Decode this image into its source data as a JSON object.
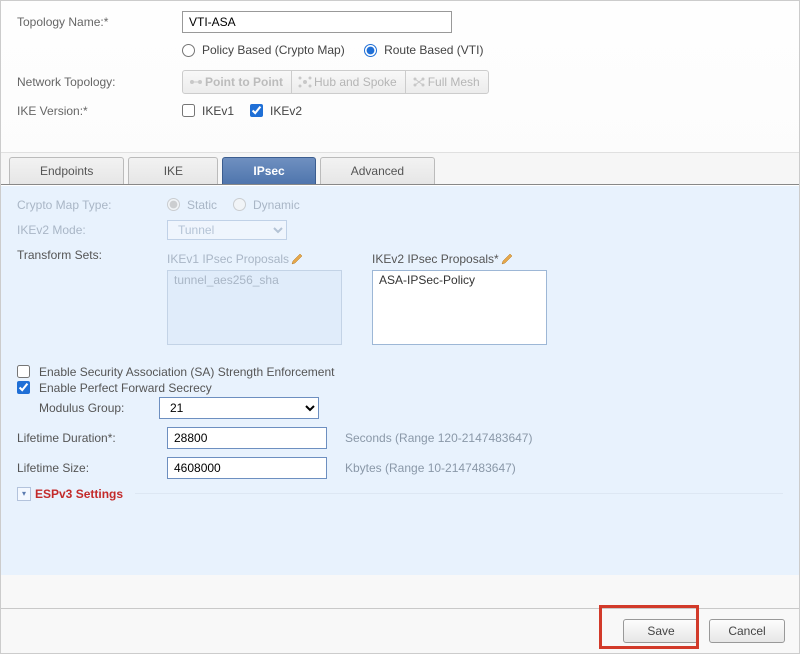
{
  "top": {
    "topology_name_label": "Topology Name:*",
    "topology_name_value": "VTI-ASA",
    "radio_policy": "Policy Based (Crypto Map)",
    "radio_route": "Route Based (VTI)",
    "network_topology_label": "Network Topology:",
    "seg_point": "Point to Point",
    "seg_hub": "Hub and Spoke",
    "seg_full": "Full Mesh",
    "ike_version_label": "IKE Version:*",
    "ikev1_label": "IKEv1",
    "ikev2_label": "IKEv2"
  },
  "tabs": {
    "endpoints": "Endpoints",
    "ike": "IKE",
    "ipsec": "IPsec",
    "advanced": "Advanced"
  },
  "ipsec": {
    "crypto_map_type_label": "Crypto Map Type:",
    "crypto_static": "Static",
    "crypto_dynamic": "Dynamic",
    "ikev2_mode_label": "IKEv2 Mode:",
    "ikev2_mode_value": "Tunnel",
    "transform_sets_label": "Transform Sets:",
    "ikev1_prop_label": "IKEv1 IPsec Proposals",
    "ikev1_prop_item": "tunnel_aes256_sha",
    "ikev2_prop_label": "IKEv2 IPsec Proposals*",
    "ikev2_prop_item": "ASA-IPSec-Policy",
    "sa_enforce_label": "Enable Security Association (SA) Strength Enforcement",
    "pfs_label": "Enable Perfect Forward Secrecy",
    "modulus_label": "Modulus Group:",
    "modulus_value": "21",
    "lifetime_dur_label": "Lifetime Duration*:",
    "lifetime_dur_value": "28800",
    "lifetime_dur_hint": "Seconds (Range 120-2147483647)",
    "lifetime_size_label": "Lifetime Size:",
    "lifetime_size_value": "4608000",
    "lifetime_size_hint": "Kbytes (Range 10-2147483647)",
    "espv3_label": "ESPv3 Settings"
  },
  "footer": {
    "save": "Save",
    "cancel": "Cancel"
  }
}
